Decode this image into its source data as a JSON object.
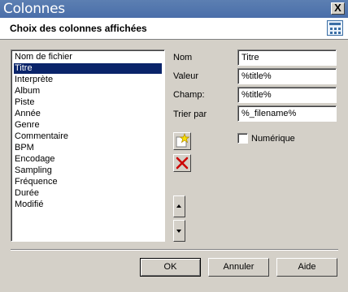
{
  "window": {
    "title": "Colonnes",
    "close_label": "X"
  },
  "header": {
    "text": "Choix des colonnes affichées"
  },
  "columns": {
    "items": [
      "Nom de fichier",
      "Titre",
      "Interprète",
      "Album",
      "Piste",
      "Année",
      "Genre",
      "Commentaire",
      "BPM",
      "Encodage",
      "Sampling",
      "Fréquence",
      "Durée",
      "Modifié"
    ],
    "selected_index": 1
  },
  "fields": {
    "nom": {
      "label": "Nom",
      "value": "Titre"
    },
    "valeur": {
      "label": "Valeur",
      "value": "%title%"
    },
    "champ": {
      "label": "Champ:",
      "value": "%title%"
    },
    "trier": {
      "label": "Trier par",
      "value": "%_filename%"
    }
  },
  "numerique": {
    "label": "Numérique",
    "checked": false
  },
  "icons": {
    "new": "new-star-icon",
    "delete": "delete-x-icon",
    "up": "arrow-up-icon",
    "down": "arrow-down-icon",
    "header": "columns-grid-icon"
  },
  "buttons": {
    "ok": "OK",
    "annuler": "Annuler",
    "aide": "Aide"
  },
  "colors": {
    "title_bar": "#4a6ea9",
    "selection": "#0a246a",
    "delete_red": "#cc0000"
  }
}
